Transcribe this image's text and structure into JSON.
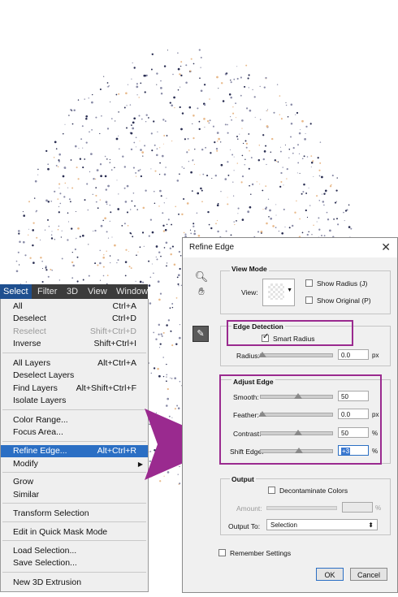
{
  "menubar": {
    "items": [
      "Select",
      "Filter",
      "3D",
      "View",
      "Window"
    ]
  },
  "menu": {
    "items": [
      {
        "label": "All",
        "shortcut": "Ctrl+A"
      },
      {
        "label": "Deselect",
        "shortcut": "Ctrl+D"
      },
      {
        "label": "Reselect",
        "shortcut": "Shift+Ctrl+D",
        "disabled": true
      },
      {
        "label": "Inverse",
        "shortcut": "Shift+Ctrl+I"
      },
      {
        "label": "All Layers",
        "shortcut": "Alt+Ctrl+A"
      },
      {
        "label": "Deselect Layers",
        "shortcut": ""
      },
      {
        "label": "Find Layers",
        "shortcut": "Alt+Shift+Ctrl+F"
      },
      {
        "label": "Isolate Layers",
        "shortcut": ""
      },
      {
        "label": "Color Range...",
        "shortcut": ""
      },
      {
        "label": "Focus Area...",
        "shortcut": ""
      },
      {
        "label": "Refine Edge...",
        "shortcut": "Alt+Ctrl+R",
        "highlighted": true
      },
      {
        "label": "Modify",
        "shortcut": "",
        "submenu": true
      },
      {
        "label": "Grow",
        "shortcut": ""
      },
      {
        "label": "Similar",
        "shortcut": ""
      },
      {
        "label": "Transform Selection",
        "shortcut": ""
      },
      {
        "label": "Edit in Quick Mask Mode",
        "shortcut": ""
      },
      {
        "label": "Load Selection...",
        "shortcut": ""
      },
      {
        "label": "Save Selection...",
        "shortcut": ""
      },
      {
        "label": "New 3D Extrusion",
        "shortcut": ""
      }
    ]
  },
  "dialog": {
    "title": "Refine Edge",
    "close": "✕",
    "view_mode": {
      "heading": "View Mode",
      "view_label": "View:",
      "show_radius": "Show Radius (J)",
      "show_original": "Show Original (P)"
    },
    "edge_detection": {
      "heading": "Edge Detection",
      "smart_radius": "Smart Radius",
      "radius_label": "Radius:",
      "radius_value": "0.0",
      "radius_unit": "px"
    },
    "adjust_edge": {
      "heading": "Adjust Edge",
      "rows": [
        {
          "label": "Smooth:",
          "value": "50",
          "unit": ""
        },
        {
          "label": "Feather:",
          "value": "0.0",
          "unit": "px"
        },
        {
          "label": "Contrast:",
          "value": "50",
          "unit": "%"
        },
        {
          "label": "Shift Edge:",
          "value": "+3",
          "unit": "%"
        }
      ]
    },
    "output": {
      "heading": "Output",
      "decontaminate": "Decontaminate Colors",
      "amount_label": "Amount:",
      "amount_unit": "%",
      "output_to_label": "Output To:",
      "output_to_value": "Selection"
    },
    "remember": "Remember Settings",
    "ok": "OK",
    "cancel": "Cancel"
  },
  "colors": {
    "annotation": "#9a2a8f",
    "menu_highlight": "#2b6fc4",
    "menubar_active": "#1e4f8f"
  }
}
